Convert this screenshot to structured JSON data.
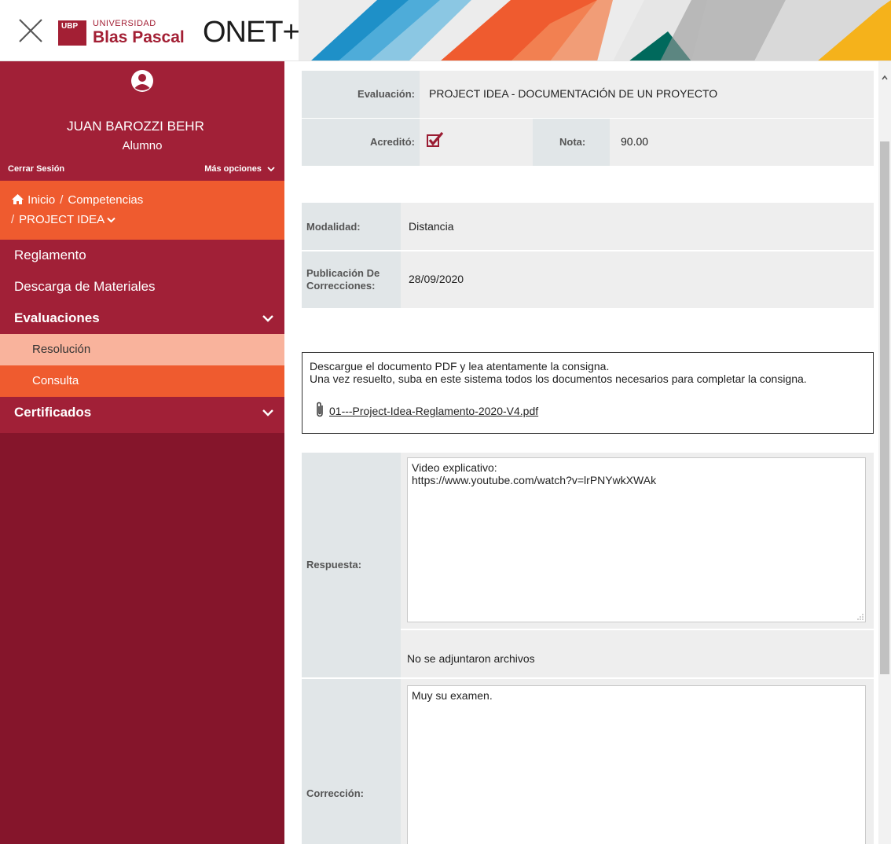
{
  "header": {
    "close_icon": "close-icon",
    "logo_badge": "UBP",
    "logo_small": "UNIVERSIDAD",
    "logo_big": "Blas Pascal",
    "app_logo": "ONET+",
    "brand_color": "#a31f34",
    "decor_colors": [
      "#1e90c8",
      "#ef5b2f",
      "#00695c",
      "#f5b21b",
      "#8a8a8a"
    ]
  },
  "sidebar": {
    "user_name": "JUAN BAROZZI BEHR",
    "user_role": "Alumno",
    "logout": "Cerrar Sesión",
    "more_options": "Más opciones",
    "breadcrumb": {
      "home": "Inicio",
      "competencias": "Competencias",
      "current": "PROJECT IDEA"
    },
    "items": [
      {
        "label": "Reglamento"
      },
      {
        "label": "Descarga de Materiales"
      },
      {
        "label": "Evaluaciones"
      },
      {
        "label": "Resolución"
      },
      {
        "label": "Consulta"
      },
      {
        "label": "Certificados"
      }
    ],
    "colors": {
      "bg": "#85152b",
      "item": "#a12037",
      "orange": "#ef5b2f",
      "active": "#f9b39c"
    }
  },
  "evaluation": {
    "eval_label": "Evaluación:",
    "eval_value": "PROJECT IDEA - DOCUMENTACIÓN DE UN PROYECTO",
    "acredito_label": "Acreditó:",
    "acredito_checked": true,
    "nota_label": "Nota:",
    "nota_value": "90.00"
  },
  "details": {
    "modalidad_label": "Modalidad:",
    "modalidad_value": "Distancia",
    "publicacion_label_1": "Publicación De",
    "publicacion_label_2": "Correcciones:",
    "publicacion_value": "28/09/2020"
  },
  "consigna": {
    "line1": "Descargue el documento PDF y lea atentamente la consigna.",
    "line2": "Una vez resuelto, suba en este sistema todos los documentos necesarios para completar la consigna.",
    "attachment": "01---Project-Idea-Reglamento-2020-V4.pdf"
  },
  "respuesta": {
    "label": "Respuesta:",
    "text": "Video explicativo:\nhttps://www.youtube.com/watch?v=lrPNYwkXWAk",
    "files_note": "No se adjuntaron archivos"
  },
  "correccion": {
    "label": "Corrección:",
    "text": "Muy su examen."
  }
}
